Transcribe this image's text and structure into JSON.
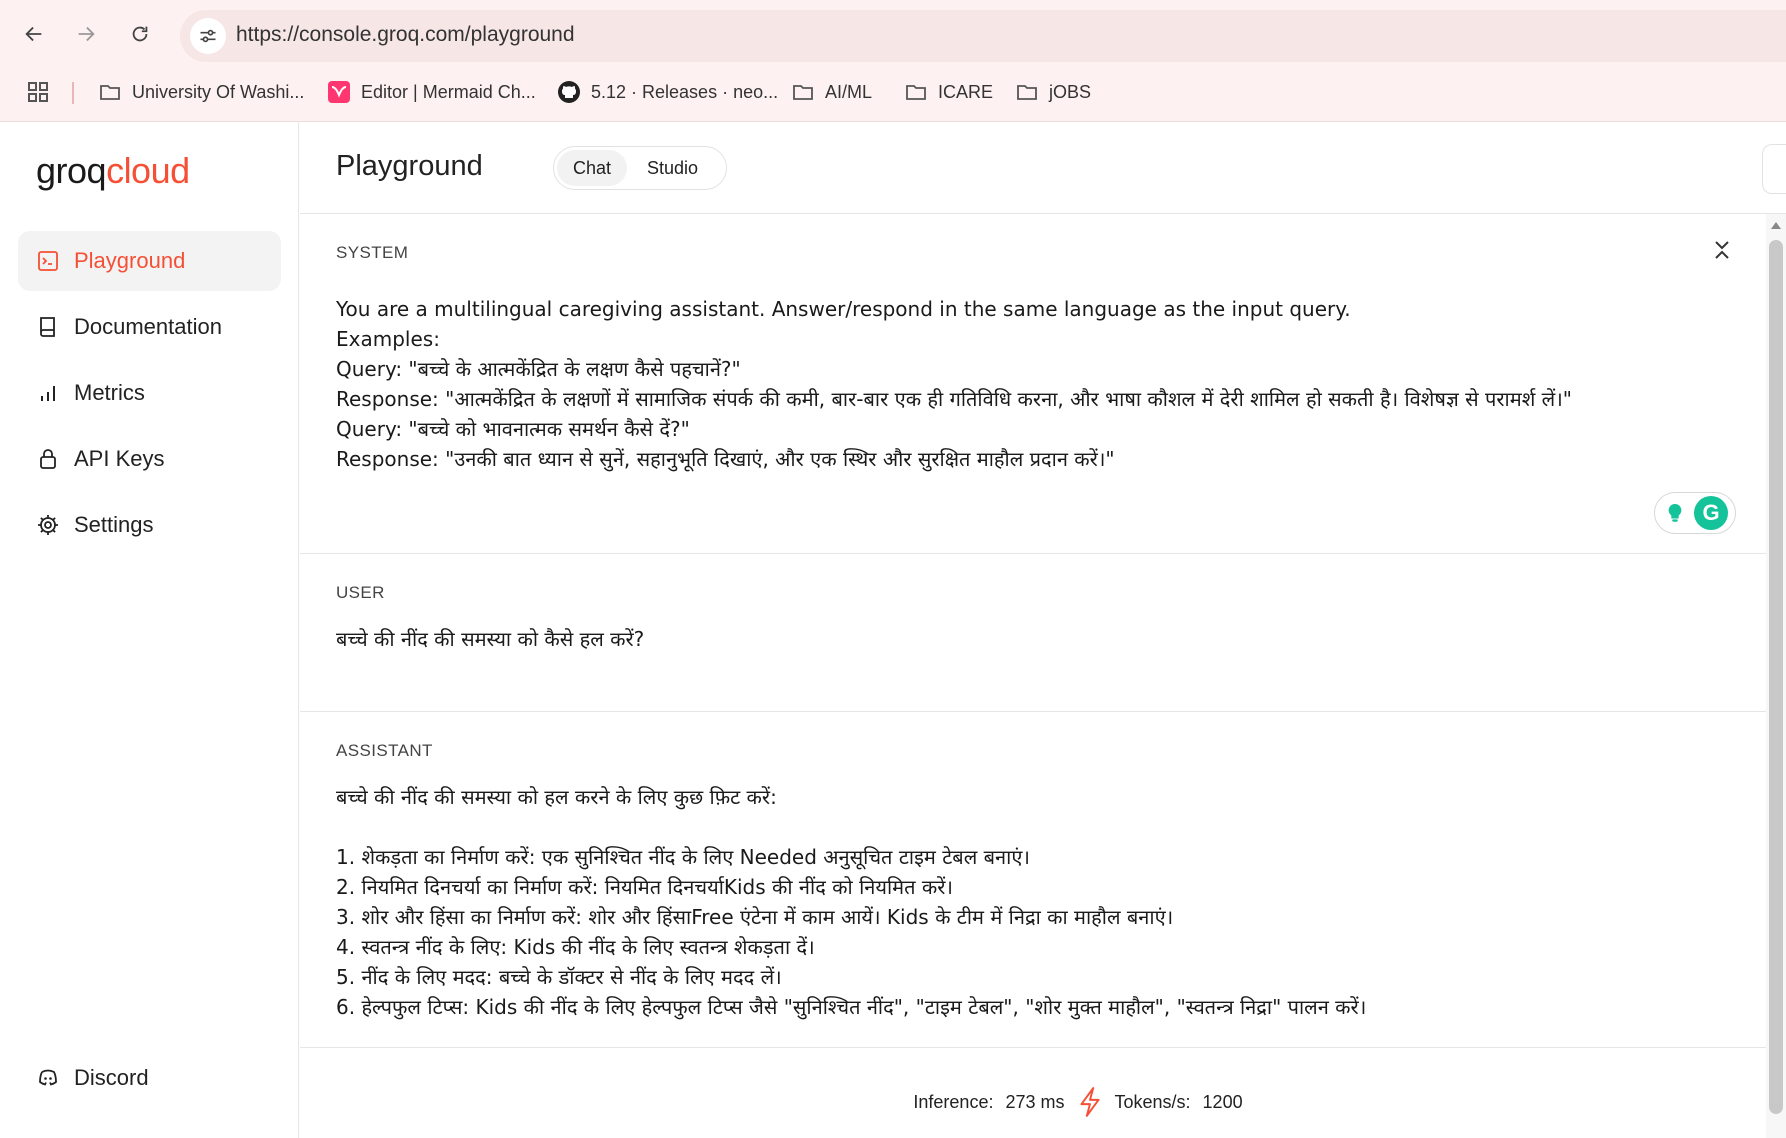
{
  "browser": {
    "url": "https://console.groq.com/playground",
    "icons": {
      "back": "back-arrow-icon",
      "forward": "forward-arrow-icon",
      "reload": "reload-icon",
      "site_info": "tune-icon",
      "apps": "apps-grid-icon"
    },
    "bookmarks": [
      {
        "label": "University Of Washi...",
        "icon": "folder-icon"
      },
      {
        "label": "Editor | Mermaid Ch...",
        "icon": "mermaid-icon"
      },
      {
        "label": "5.12 · Releases · neo...",
        "icon": "github-icon"
      },
      {
        "label": "AI/ML",
        "icon": "folder-icon"
      },
      {
        "label": "ICARE",
        "icon": "folder-icon"
      },
      {
        "label": "jOBS",
        "icon": "folder-icon"
      }
    ]
  },
  "sidebar": {
    "logo_part1": "groq",
    "logo_part2": "cloud",
    "items": [
      {
        "label": "Playground",
        "icon": "terminal-icon",
        "active": true
      },
      {
        "label": "Documentation",
        "icon": "book-icon",
        "active": false
      },
      {
        "label": "Metrics",
        "icon": "bar-chart-icon",
        "active": false
      },
      {
        "label": "API Keys",
        "icon": "lock-icon",
        "active": false
      },
      {
        "label": "Settings",
        "icon": "gear-icon",
        "active": false
      }
    ],
    "discord": {
      "label": "Discord",
      "icon": "discord-icon"
    }
  },
  "header": {
    "title": "Playground",
    "tabs": [
      {
        "label": "Chat",
        "selected": true
      },
      {
        "label": "Studio",
        "selected": false
      }
    ]
  },
  "system": {
    "label": "SYSTEM",
    "text": "You are a multilingual caregiving assistant. Answer/respond in the same language as the input query.\nExamples:\nQuery: \"बच्चे के आत्मकेंद्रित के लक्षण कैसे पहचानें?\"\nResponse: \"आत्मकेंद्रित के लक्षणों में सामाजिक संपर्क की कमी, बार-बार एक ही गतिविधि करना, और भाषा कौशल में देरी शामिल हो सकती है। विशेषज्ञ से परामर्श लें।\"\nQuery: \"बच्चे को भावनात्मक समर्थन कैसे दें?\"\nResponse: \"उनकी बात ध्यान से सुनें, सहानुभूति दिखाएं, और एक स्थिर और सुरक्षित माहौल प्रदान करें।\"",
    "collapse_icon": "collapse-icon"
  },
  "user": {
    "label": "USER",
    "text": "बच्चे की नींद की समस्या को कैसे हल करें?"
  },
  "assistant": {
    "label": "ASSISTANT",
    "text": "बच्चे की नींद की समस्या को हल करने के लिए कुछ फ़िट करें:\n\n1. शेकड़ता का निर्माण करें: एक सुनिश्चित नींद के लिए Needed अनुसूचित टाइम टेबल बनाएं।\n2. नियमित दिनचर्या का निर्माण करें: नियमित दिनचर्याKids की नींद को नियमित करें।\n3. शोर और हिंसा का निर्माण करें: शोर और हिंसाFree एंटेना में काम आयें। Kids के टीम में निद्रा का माहौल बनाएं।\n4. स्वतन्त्र नींद के लिए: Kids की नींद के लिए स्वतन्त्र शेकड़ता दें।\n5. नींद के लिए मदद: बच्चे के डॉक्टर से नींद के लिए मदद लें।\n6. हेल्पफुल टिप्स: Kids की नींद के लिए हेल्पफुल टिप्स जैसे \"सुनिश्चित नींद\", \"टाइम टेबल\", \"शोर मुक्त माहौल\", \"स्वतन्त्र निद्रा\" पालन करें।"
  },
  "stats": {
    "inference_label": "Inference:",
    "inference_value": "273 ms",
    "tokens_label": "Tokens/s:",
    "tokens_value": "1200",
    "icon": "lightning-icon"
  },
  "colors": {
    "accent": "#f55036",
    "active_bg": "#f3f3f3",
    "chrome_bg": "#fdf2f1"
  }
}
